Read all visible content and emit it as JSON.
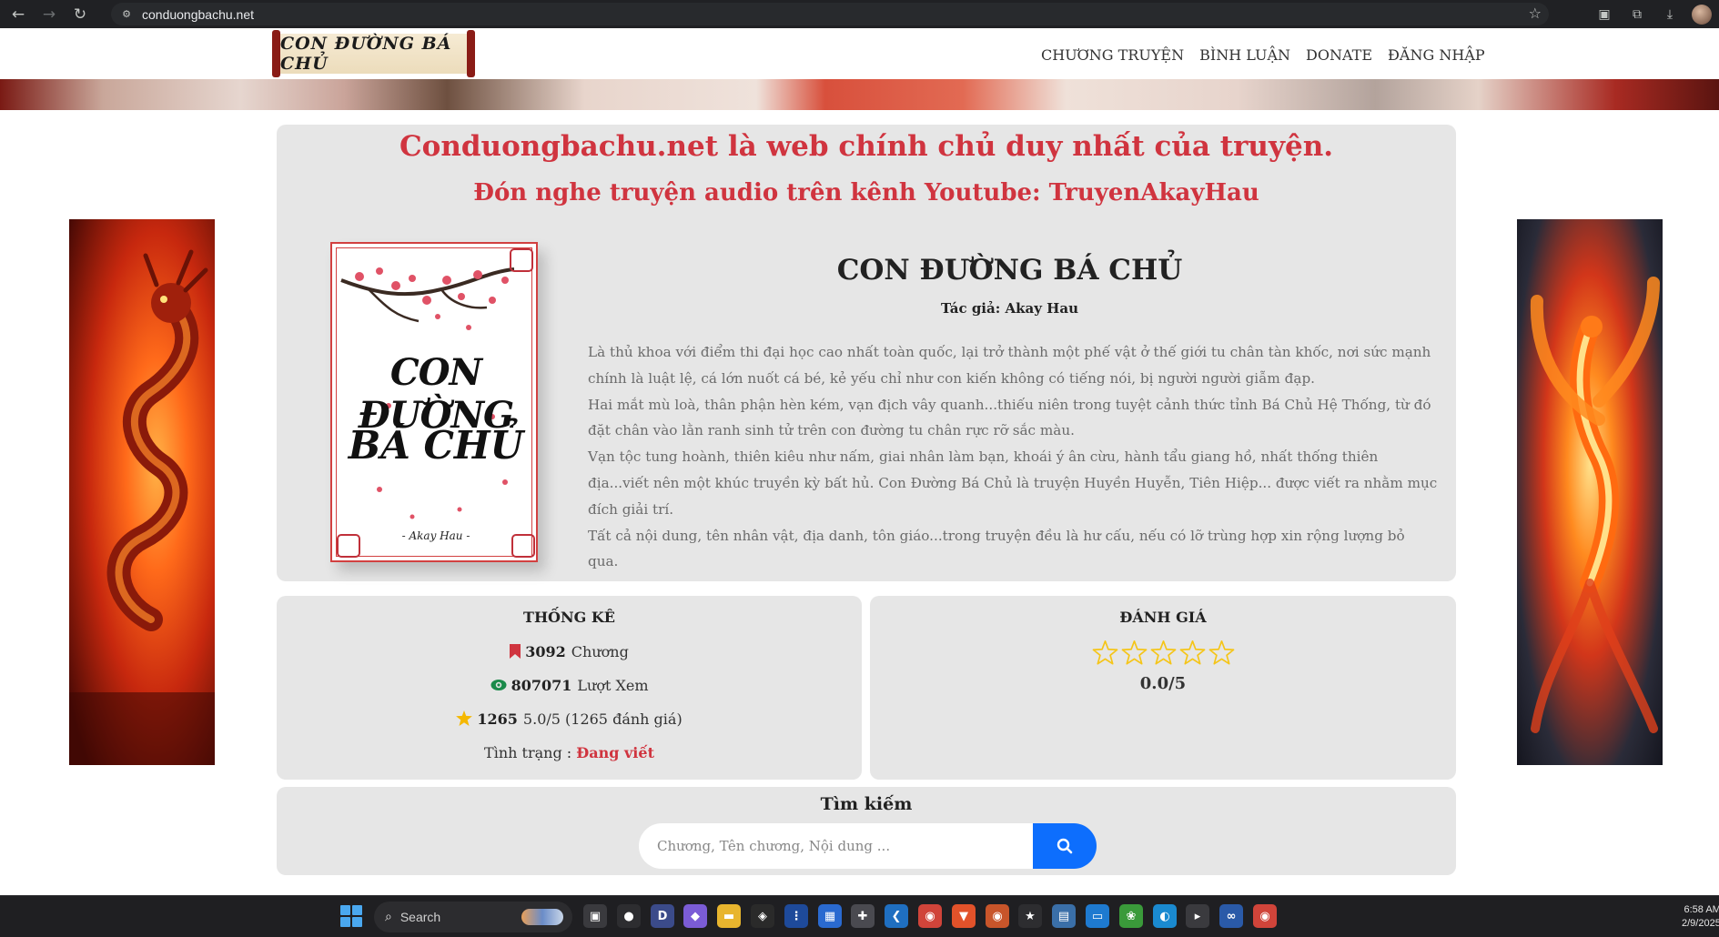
{
  "browser": {
    "url": "conduongbachu.net",
    "back_icon": "←",
    "forward_icon": "→",
    "reload_icon": "↻",
    "site_info_icon": "⚙",
    "bookmark_icon": "☆"
  },
  "header": {
    "logo_text": "CON ĐƯỜNG BÁ CHỦ",
    "nav": [
      {
        "label": "CHƯƠNG TRUYỆN"
      },
      {
        "label": "BÌNH LUẬN"
      },
      {
        "label": "DONATE"
      },
      {
        "label": "ĐĂNG NHẬP"
      }
    ]
  },
  "notice": {
    "line1": "Conduongbachu.net là web chính chủ duy nhất của truyện.",
    "line2": "Đón nghe truyện audio trên kênh Youtube: TruyenAkayHau"
  },
  "book": {
    "cover_title_1": "CON ĐƯỜNG",
    "cover_title_2": "BÁ CHỦ",
    "cover_author": "- Akay Hau -",
    "title": "CON ĐƯỜNG BÁ CHỦ",
    "author_label": "Tác giả: ",
    "author_name": "Akay Hau",
    "description": [
      "Là thủ khoa với điểm thi đại học cao nhất toàn quốc, lại trở thành một phế vật ở thế giới tu chân tàn khốc, nơi sức mạnh chính là luật lệ, cá lớn nuốt cá bé, kẻ yếu chỉ như con kiến không có tiếng nói, bị người người giẫm đạp.",
      "Hai mắt mù loà, thân phận hèn kém, vạn địch vây quanh...thiếu niên trong tuyệt cảnh thức tỉnh Bá Chủ Hệ Thống, từ đó đặt chân vào lằn ranh sinh tử trên con đường tu chân rực rỡ sắc màu.",
      "Vạn tộc tung hoành, thiên kiêu như nấm, giai nhân làm bạn, khoái ý ân cừu, hành tẩu giang hồ, nhất thống thiên địa...viết nên một khúc truyền kỳ bất hủ. Con Đường Bá Chủ là truyện Huyền Huyễn, Tiên Hiệp... được viết ra nhằm mục đích giải trí.",
      "Tất cả nội dung, tên nhân vật, địa danh, tôn giáo...trong truyện đều là hư cấu, nếu có lỡ trùng hợp xin rộng lượng bỏ qua."
    ]
  },
  "stats": {
    "title": "THỐNG KÊ",
    "chapters_value": "3092",
    "chapters_label": "Chương",
    "views_value": "807071",
    "views_label": "Lượt Xem",
    "ratings_count": "1265",
    "ratings_label": "5.0/5 (1265 đánh giá)",
    "status_label": "Tình trạng : ",
    "status_value": "Đang viết",
    "colors": {
      "bookmark": "#d0343f",
      "eye": "#1a8a4a",
      "star": "#f5b800"
    }
  },
  "rating": {
    "title": "ĐÁNH GIÁ",
    "stars_total": 5,
    "stars_filled": 0,
    "score": "0.0/5",
    "star_color": "#f5c518"
  },
  "search": {
    "title": "Tìm kiếm",
    "placeholder": "Chương, Tên chương, Nội dung ...",
    "button_color": "#0d6efd"
  },
  "taskbar": {
    "search_label": "Search",
    "time": "6:58 AM",
    "date": "2/9/2025",
    "apps": [
      {
        "name": "task-view-icon",
        "glyph": "▣",
        "color": "#3a3a3e"
      },
      {
        "name": "github-icon",
        "glyph": "●",
        "color": "#2d2d30"
      },
      {
        "name": "dev-icon",
        "glyph": "D",
        "color": "#3b4b8a"
      },
      {
        "name": "copilot-icon",
        "glyph": "◆",
        "color": "#7b5cd6"
      },
      {
        "name": "folder-icon",
        "glyph": "▬",
        "color": "#e8b52e"
      },
      {
        "name": "binance-icon",
        "glyph": "◈",
        "color": "#2a2a2a"
      },
      {
        "name": "app-grid-icon",
        "glyph": "⋮",
        "color": "#1e4a9a"
      },
      {
        "name": "store-icon",
        "glyph": "▦",
        "color": "#2a6ad0"
      },
      {
        "name": "puzzle-icon",
        "glyph": "✚",
        "color": "#4a4a50"
      },
      {
        "name": "vscode-icon",
        "glyph": "❮",
        "color": "#1f6fc1"
      },
      {
        "name": "chrome-icon",
        "glyph": "◉",
        "color": "#d0443a"
      },
      {
        "name": "brave-icon",
        "glyph": "▼",
        "color": "#e2522a"
      },
      {
        "name": "chrome-alt-icon",
        "glyph": "◉",
        "color": "#c8552a"
      },
      {
        "name": "star-app-icon",
        "glyph": "★",
        "color": "#2d2d30"
      },
      {
        "name": "photos-icon",
        "glyph": "▤",
        "color": "#3a6fa8"
      },
      {
        "name": "window-app-icon",
        "glyph": "▭",
        "color": "#1e7ad0"
      },
      {
        "name": "spring-icon",
        "glyph": "❀",
        "color": "#3a9a3a"
      },
      {
        "name": "edge-icon",
        "glyph": "◐",
        "color": "#1a8ad0"
      },
      {
        "name": "terminal-icon",
        "glyph": "▸",
        "color": "#3a3a3e"
      },
      {
        "name": "vs-icon",
        "glyph": "∞",
        "color": "#2a5aa8"
      },
      {
        "name": "chrome-profile-icon",
        "glyph": "◉",
        "color": "#d0443a"
      }
    ]
  }
}
